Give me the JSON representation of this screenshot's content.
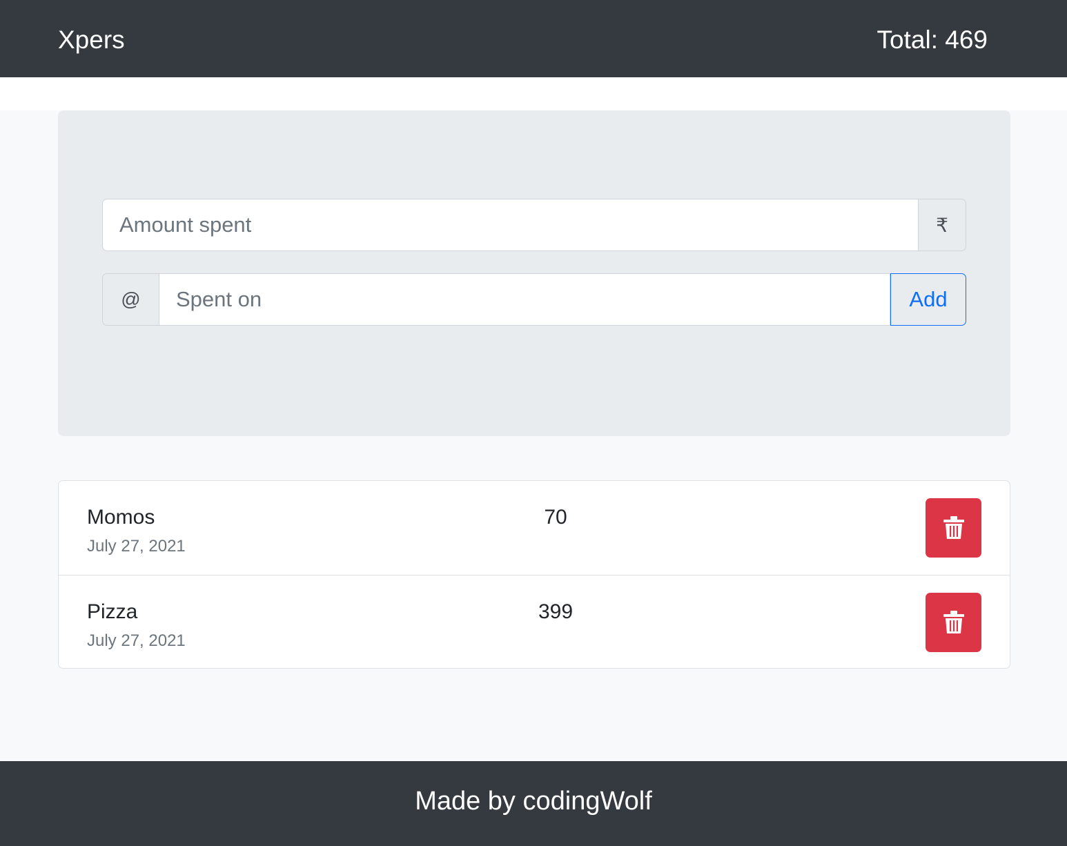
{
  "navbar": {
    "brand": "Xpers",
    "total_label": "Total: 469"
  },
  "form": {
    "amount_placeholder": "Amount spent",
    "currency_symbol": "₹",
    "at_symbol": "@",
    "spent_on_placeholder": "Spent on",
    "add_label": "Add"
  },
  "expenses": [
    {
      "name": "Momos",
      "date": "July 27, 2021",
      "amount": "70",
      "delete_icon": "trash-icon"
    },
    {
      "name": "Pizza",
      "date": "July 27, 2021",
      "amount": "399",
      "delete_icon": "trash-icon"
    }
  ],
  "footer": {
    "text": "Made by codingWolf"
  },
  "colors": {
    "navbar_bg": "#343a40",
    "jumbotron_bg": "#e9ecef",
    "primary": "#0d6efd",
    "danger": "#dc3545",
    "muted": "#6c757d"
  }
}
